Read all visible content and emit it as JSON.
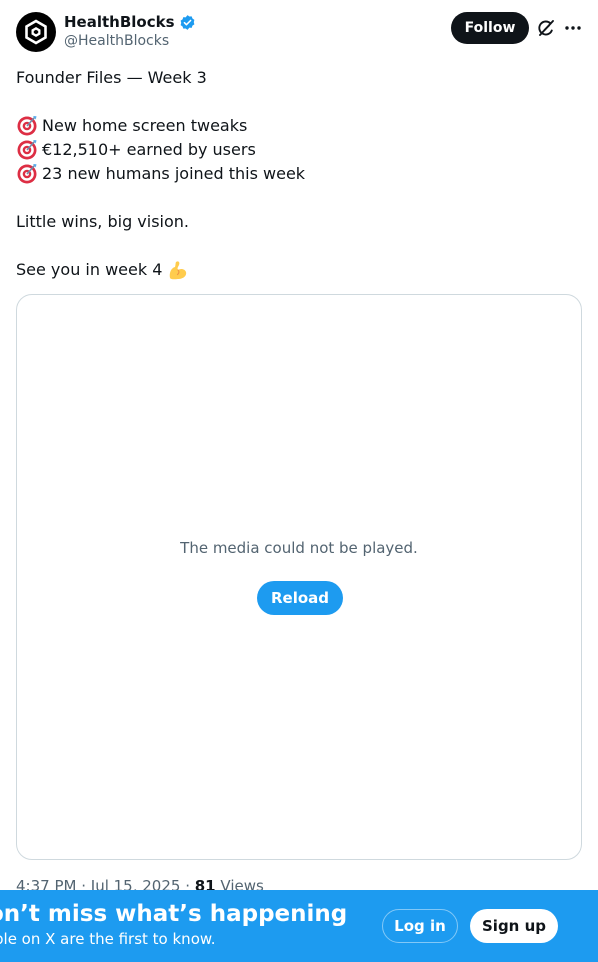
{
  "author": {
    "name": "HealthBlocks",
    "handle": "@HealthBlocks",
    "verified": true
  },
  "header": {
    "follow_label": "Follow"
  },
  "tweet": {
    "lines": [
      "Founder Files — Week 3",
      "New home screen tweaks",
      "€12,510+ earned by users",
      "23 new humans joined this week",
      "Little wins, big vision.",
      "See you in week 4"
    ]
  },
  "media": {
    "error_text": "The media could not be played.",
    "reload_label": "Reload"
  },
  "meta": {
    "time": "4:37 PM",
    "date": "Jul 15, 2025",
    "separator": " · ",
    "views_count": "81",
    "views_label": "Views"
  },
  "banner": {
    "title": "on’t miss what’s happening",
    "subtitle": "ple on X are the first to know.",
    "login_label": "Log in",
    "signup_label": "Sign up"
  },
  "colors": {
    "accent": "#1d9bf0",
    "text": "#0f1419",
    "muted": "#536471",
    "border": "#cfd9de"
  },
  "icons": [
    "healthblocks-logo-icon",
    "verified-badge-icon",
    "grok-icon",
    "more-options-icon",
    "target-emoji-icon",
    "flexed-biceps-emoji-icon"
  ]
}
